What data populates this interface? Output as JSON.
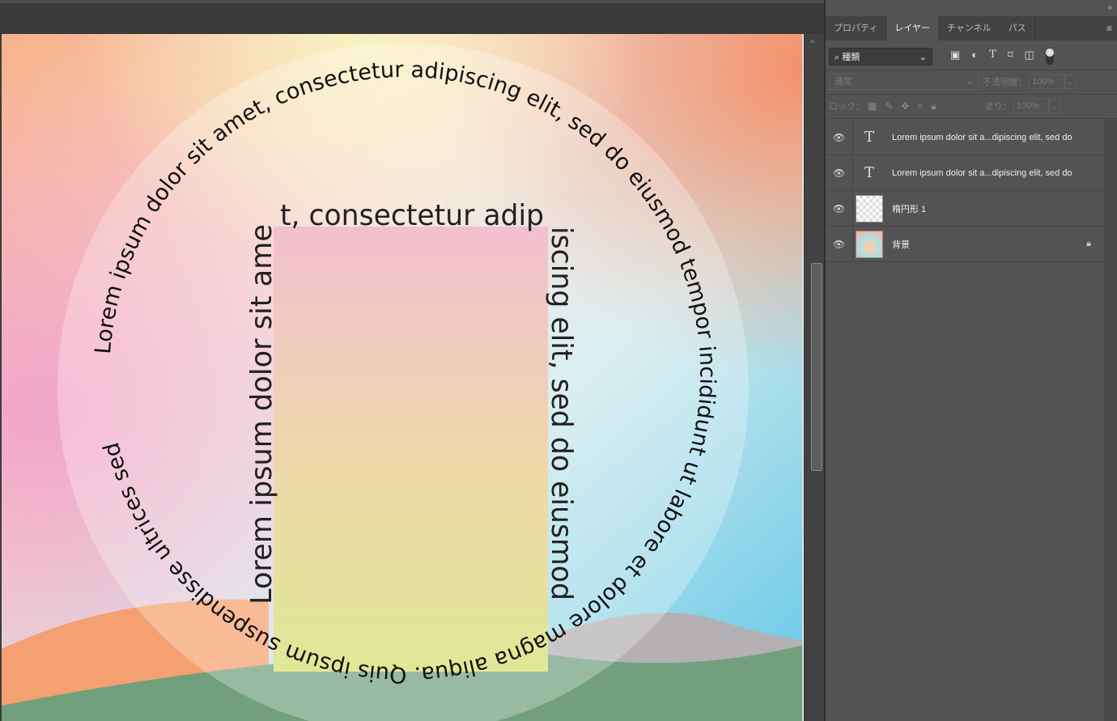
{
  "panel": {
    "tabs": [
      {
        "label": "プロパティ"
      },
      {
        "label": "レイヤー",
        "active": true
      },
      {
        "label": "チャンネル"
      },
      {
        "label": "パス"
      }
    ],
    "filter_kind": "種類",
    "blend_mode": "通常",
    "opacity_label": "不透明度：",
    "opacity_value": "100%",
    "lock_label": "ロック：",
    "fill_label": "塗り：",
    "fill_value": "100%",
    "layers": [
      {
        "type": "text",
        "name": "Lorem ipsum dolor sit a...dipiscing elit, sed do",
        "visible": true
      },
      {
        "type": "text",
        "name": "Lorem ipsum dolor sit a...dipiscing elit, sed do",
        "visible": true
      },
      {
        "type": "shape",
        "name": "楕円形 1",
        "visible": true
      },
      {
        "type": "background",
        "name": "背景",
        "visible": true,
        "locked": true
      }
    ]
  },
  "canvas": {
    "circle_text": "Lorem ipsum dolor sit amet, consectetur adipiscing elit, sed do eiusmod tempor incididunt ut labore et dolore magna aliqua. Quis ipsum suspendisse ultrices sed",
    "rect_top_text": "t, consectetur adip",
    "rect_left_text": "Lorem ipsum dolor sit ame",
    "rect_right_text": "iscing elit, sed do eiusmod"
  },
  "colors": {
    "panel_bg": "#535353",
    "rect_top": "#f2bfd0",
    "rect_bottom": "#dfe896"
  }
}
